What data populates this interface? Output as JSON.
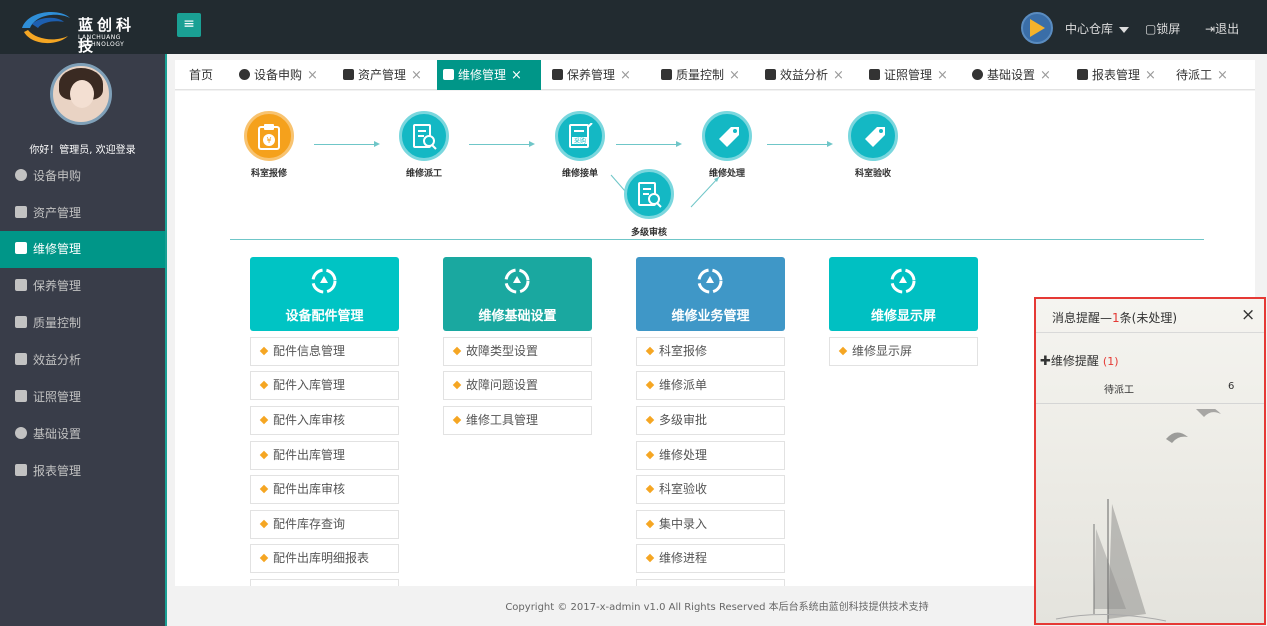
{
  "brand": {
    "title": "蓝创科技",
    "subtitle": "LANCHUANG TECHNOLOGY"
  },
  "topbar": {
    "store": "中心仓库",
    "lock": "锁屏",
    "exit": "退出"
  },
  "sidebar": {
    "welcome": "你好！管理员, 欢迎登录",
    "items": [
      {
        "label": "设备申购",
        "icon": "device-purchase-icon"
      },
      {
        "label": "资产管理",
        "icon": "asset-icon"
      },
      {
        "label": "维修管理",
        "icon": "repair-icon",
        "active": true
      },
      {
        "label": "保养管理",
        "icon": "maintenance-icon"
      },
      {
        "label": "质量控制",
        "icon": "shield-icon"
      },
      {
        "label": "效益分析",
        "icon": "document-icon"
      },
      {
        "label": "证照管理",
        "icon": "certificate-icon"
      },
      {
        "label": "基础设置",
        "icon": "gear-icon"
      },
      {
        "label": "报表管理",
        "icon": "report-icon"
      }
    ]
  },
  "tabs": [
    {
      "label": "首页"
    },
    {
      "label": "设备申购"
    },
    {
      "label": "资产管理"
    },
    {
      "label": "维修管理",
      "active": true
    },
    {
      "label": "保养管理"
    },
    {
      "label": "质量控制"
    },
    {
      "label": "效益分析"
    },
    {
      "label": "证照管理"
    },
    {
      "label": "基础设置"
    },
    {
      "label": "报表管理"
    },
    {
      "label": "待派工"
    }
  ],
  "flow": {
    "nodes": [
      {
        "label": "科室报修",
        "color": "orange",
        "icon": "clipboard-money-icon"
      },
      {
        "label": "维修派工",
        "color": "teal",
        "icon": "document-search-icon"
      },
      {
        "label": "维修接单",
        "color": "teal",
        "icon": "purchase-order-icon",
        "badge": "采购"
      },
      {
        "label": "维修处理",
        "color": "teal",
        "icon": "tag-icon"
      },
      {
        "label": "科室验收",
        "color": "teal",
        "icon": "tag-icon"
      },
      {
        "label": "多级审核",
        "color": "teal",
        "icon": "document-search-icon"
      }
    ]
  },
  "categories": [
    {
      "title": "设备配件管理",
      "color": "#00c4c4",
      "links": [
        "配件信息管理",
        "配件入库管理",
        "配件入库审核",
        "配件出库管理",
        "配件出库审核",
        "配件库存查询",
        "配件出库明细报表"
      ]
    },
    {
      "title": "维修基础设置",
      "color": "#1aa8a0",
      "links": [
        "故障类型设置",
        "故障问题设置",
        "维修工具管理"
      ]
    },
    {
      "title": "维修业务管理",
      "color": "#3f97c7",
      "links": [
        "科室报修",
        "维修派单",
        "多级审批",
        "维修处理",
        "科室验收",
        "集中录入",
        "维修进程"
      ]
    },
    {
      "title": "维修显示屏",
      "color": "#00c0c2",
      "links": [
        "维修显示屏"
      ]
    }
  ],
  "footer": "Copyright © 2017-x-admin v1.0 All Rights Reserved 本后台系统由蓝创科技提供技术支持",
  "popup": {
    "title_prefix": "消息提醒—",
    "count": "1",
    "title_suffix": "条(未处理)",
    "group_label": "维修提醒",
    "group_count": "(1)",
    "row_label": "待派工",
    "row_value": "6"
  }
}
